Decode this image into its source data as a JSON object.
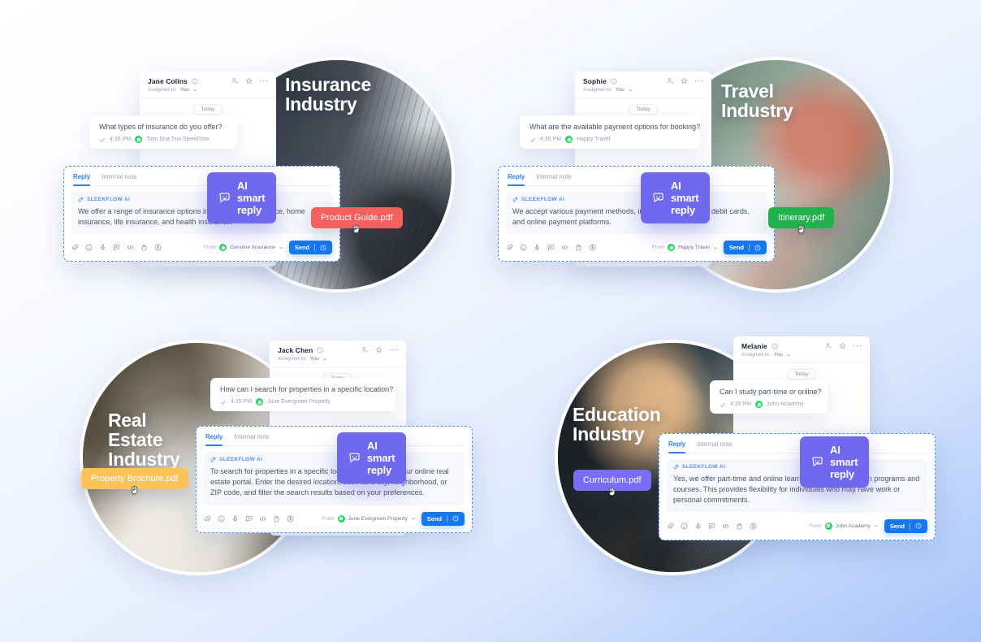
{
  "background": {
    "gradient_from": "#ffffff",
    "gradient_to": "#a8c6fa"
  },
  "common": {
    "assigned_label": "Assigned to:",
    "assigned_value": "You",
    "today_label": "Today",
    "tab_reply": "Reply",
    "tab_internal_note": "Internal note",
    "ai_tag": "SLEEKFLOW AI",
    "ai_smart_reply": "AI smart reply",
    "from_label": "From",
    "send_label": "Send",
    "time": "4:35 PM",
    "icons": {
      "info": "info-icon",
      "add_person": "add-person-icon",
      "star": "star-icon",
      "more": "more-options-icon",
      "chevron": "chevron-down-icon",
      "check": "check-icon",
      "whatsapp": "whatsapp-icon",
      "wand": "magic-wand-icon",
      "smart_reply": "chat-smiley-icon",
      "clock": "clock-icon",
      "cursor": "grab-hand-cursor-icon",
      "tools": [
        "attachment-icon",
        "emoji-icon",
        "microphone-icon",
        "quick-reply-icon",
        "code-snippet-icon",
        "shopping-bag-icon",
        "payment-icon"
      ]
    }
  },
  "panels": [
    {
      "id": "insurance",
      "title": "Insurance\nIndustry",
      "contact": "Jane Colins",
      "question": "What types of insurance do you offer?",
      "channel": "Tsim Sha Tsui SleekFlow",
      "ai_reply": "We offer a range of insurance options including auto insurance, home insurance, life insurance, and health insurance.",
      "from_account": "Genuine Insurance",
      "file": "Product Guide.pdf",
      "file_color": "#f4615c"
    },
    {
      "id": "travel",
      "title": "Travel\nIndustry",
      "contact": "Sophie",
      "question": "What are the available payment options for booking?",
      "channel": "Happy Travel",
      "ai_reply": "We accept various payment methods, including credit cards, debit cards, and online payment platforms.",
      "from_account": "Happy Travel",
      "file": "Itinerary.pdf",
      "file_color": "#22b24c"
    },
    {
      "id": "real-estate",
      "title": "Real Estate\nIndustry",
      "contact": "Jack Chen",
      "question": "How can I search for properties in a specific location?",
      "channel": "June Evergreen Property",
      "ai_reply": "To search for properties in a specific location, you can use our online real estate portal. Enter the desired location, such as a city, neighborhood, or ZIP code, and filter the search results based on your preferences.",
      "from_account": "June Evergreen Property",
      "file": "Property Brochure.pdf",
      "file_color": "#fbc35a"
    },
    {
      "id": "education",
      "title": "Education\nIndustry",
      "contact": "Melanie",
      "question": "Can I study part-time or online?",
      "channel": "John Academy",
      "ai_reply": "Yes, we offer part-time and online learning options for certain programs and courses. This provides flexibility for individuals who may have work or personal commitments.",
      "from_account": "John Academy",
      "file": "Curriculum.pdf",
      "file_color": "#7b6ef6"
    }
  ]
}
